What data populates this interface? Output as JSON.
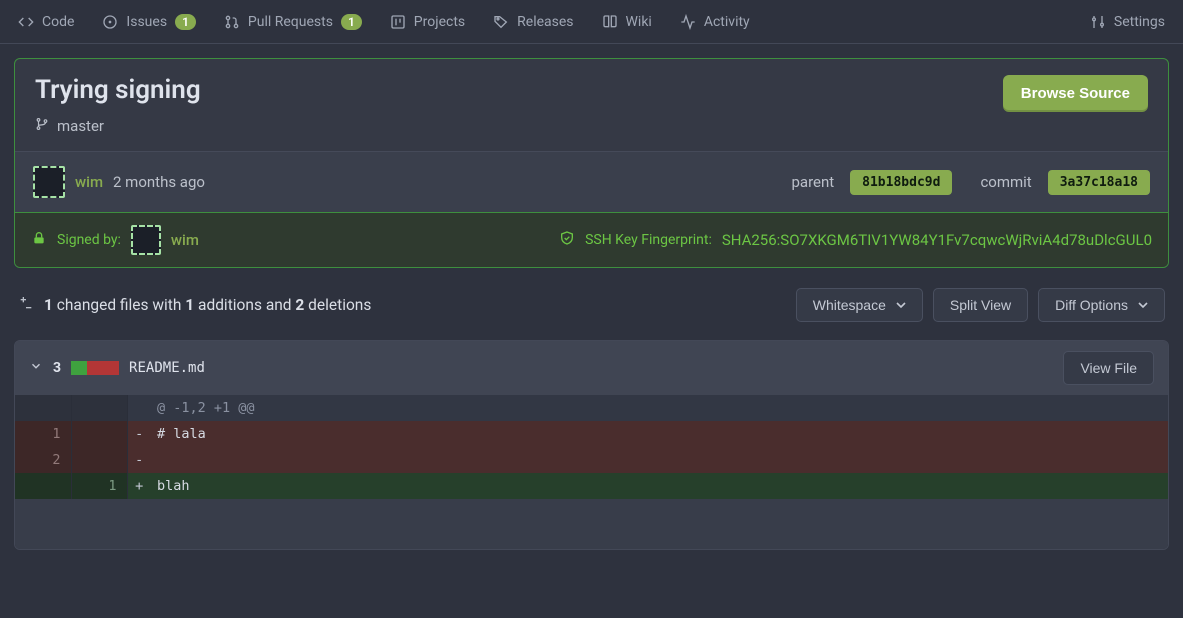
{
  "nav": {
    "code": "Code",
    "issues": "Issues",
    "issues_badge": "1",
    "prs": "Pull Requests",
    "prs_badge": "1",
    "projects": "Projects",
    "releases": "Releases",
    "wiki": "Wiki",
    "activity": "Activity",
    "settings": "Settings"
  },
  "commit": {
    "title": "Trying signing",
    "branch": "master",
    "browse_btn": "Browse Source",
    "author": "wim",
    "time": "2 months ago",
    "parent_label": "parent",
    "parent_sha": "81b18bdc9d",
    "commit_label": "commit",
    "commit_sha": "3a37c18a18",
    "signed_by_label": "Signed by:",
    "signed_author": "wim",
    "fingerprint_label": "SSH Key Fingerprint:",
    "fingerprint": "SHA256:SO7XKGM6TIV1YW84Y1Fv7cqwcWjRviA4d78uDlcGUL0"
  },
  "summary": {
    "files": "1",
    "files_label_suffix": "changed files",
    "with": "with",
    "additions": "1",
    "additions_label": "additions",
    "and": "and",
    "deletions": "2",
    "deletions_label": "deletions"
  },
  "toolbar": {
    "whitespace": "Whitespace",
    "split_view": "Split View",
    "diff_options": "Diff Options"
  },
  "file": {
    "changes": "3",
    "name": "README.md",
    "view_btn": "View File"
  },
  "diff": {
    "hunk": "@ -1,2 +1 @@",
    "l1_old": "1",
    "l1_marker": "-",
    "l1_code": "# lala",
    "l2_old": "2",
    "l2_marker": "-",
    "l2_code": "",
    "l3_new": "1",
    "l3_marker": "+",
    "l3_code": "blah"
  }
}
